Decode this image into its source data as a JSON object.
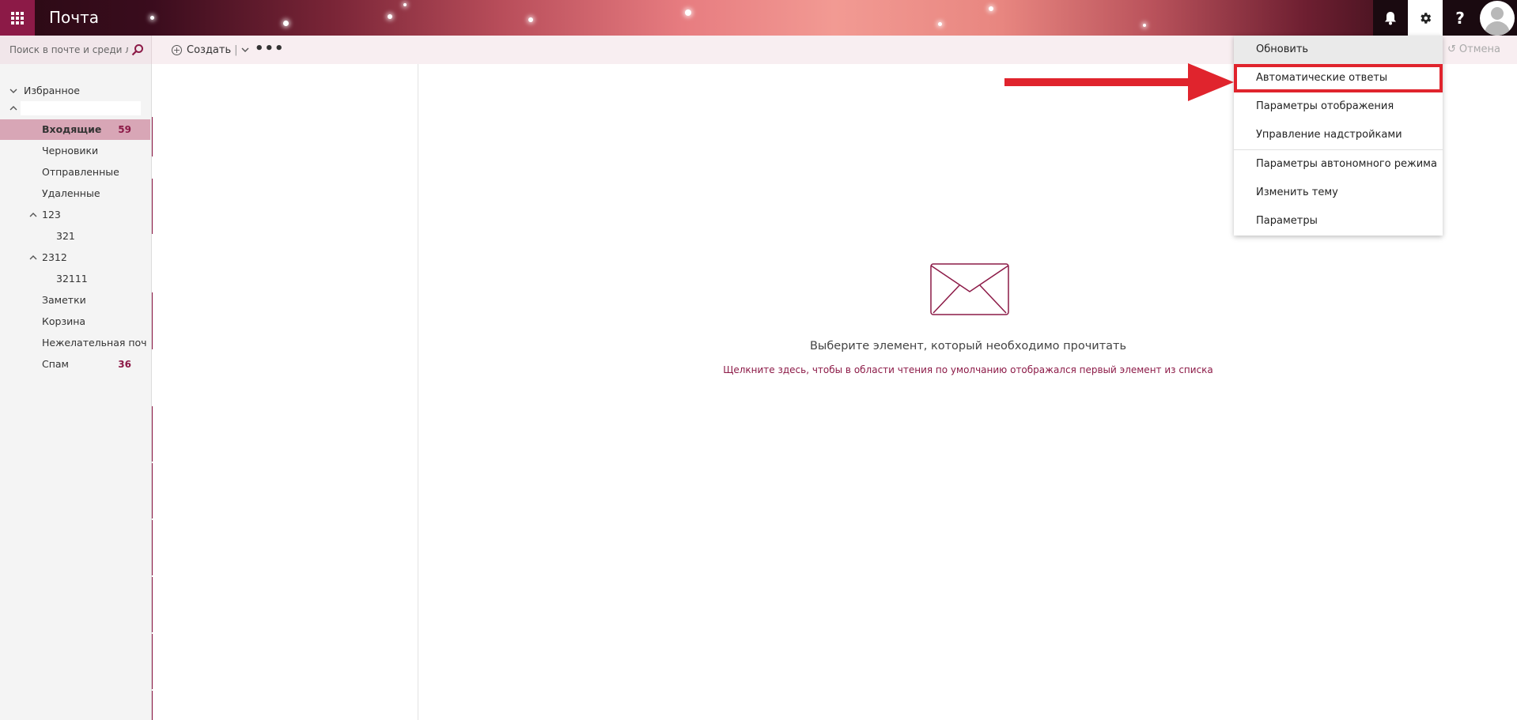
{
  "header": {
    "app_title": "Почта",
    "help_glyph": "?"
  },
  "search": {
    "placeholder": "Поиск в почте и среди л..."
  },
  "toolbar": {
    "new_label": "Создать",
    "more_label": "•••",
    "undo_label": "Отмена"
  },
  "nav": {
    "favorites": "Избранное",
    "items": [
      {
        "label": "Входящие",
        "count": "59"
      },
      {
        "label": "Черновики",
        "count": ""
      },
      {
        "label": "Отправленные",
        "count": ""
      },
      {
        "label": "Удаленные",
        "count": ""
      },
      {
        "label": "123",
        "count": ""
      },
      {
        "label": "321",
        "count": ""
      },
      {
        "label": "2312",
        "count": ""
      },
      {
        "label": "32111",
        "count": ""
      },
      {
        "label": "Заметки",
        "count": ""
      },
      {
        "label": "Корзина",
        "count": ""
      },
      {
        "label": "Нежелательная поч",
        "count": ""
      },
      {
        "label": "Спам",
        "count": "36"
      }
    ]
  },
  "reading": {
    "empty_title": "Выберите элемент, который необходимо прочитать",
    "empty_link": "Щелкните здесь, чтобы в области чтения по умолчанию отображался первый элемент из списка"
  },
  "menu": {
    "items": [
      {
        "label": "Обновить"
      },
      {
        "label": "Автоматические ответы"
      },
      {
        "label": "Параметры отображения"
      },
      {
        "label": "Управление надстройками"
      },
      {
        "label": "Параметры автономного режима"
      },
      {
        "label": "Изменить тему"
      },
      {
        "label": "Параметры"
      }
    ]
  },
  "colors": {
    "accent": "#8c1a47",
    "selected_bg": "#d8a6b6",
    "highlight": "#e0242d"
  }
}
